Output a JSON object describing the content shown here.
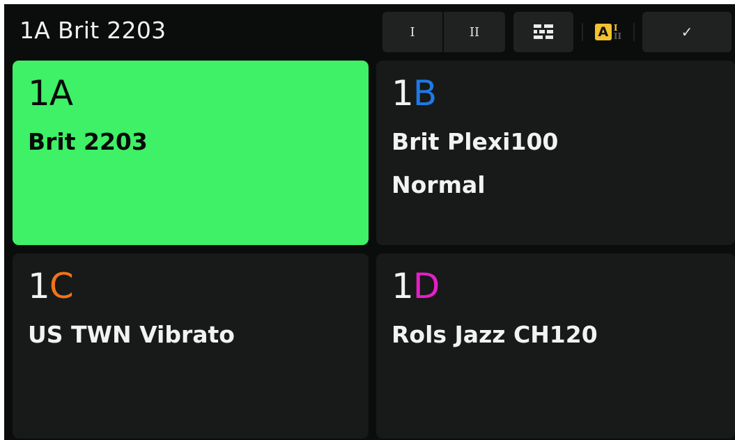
{
  "header": {
    "title": "1A Brit 2203",
    "buttons": {
      "seg_i": "I",
      "seg_ii": "II",
      "layout_icon": "grid-layout-icon",
      "ab_badge": "A",
      "ab_top": "I",
      "ab_bottom": "II",
      "check": "✓"
    }
  },
  "tiles": [
    {
      "bank": "1",
      "letter": "A",
      "letter_color": "#0a0a0a",
      "name_lines": [
        "Brit 2203"
      ],
      "active": true,
      "bg": "#3ef166"
    },
    {
      "bank": "1",
      "letter": "B",
      "letter_color": "#1f7ae6",
      "name_lines": [
        "Brit Plexi100",
        "Normal"
      ],
      "active": false
    },
    {
      "bank": "1",
      "letter": "C",
      "letter_color": "#f0741a",
      "name_lines": [
        "US TWN Vibrato"
      ],
      "active": false
    },
    {
      "bank": "1",
      "letter": "D",
      "letter_color": "#e61fc4",
      "name_lines": [
        "Rols Jazz CH120"
      ],
      "active": false
    }
  ],
  "colors": {
    "background": "#0b0d0c",
    "tile": "#171a18",
    "active_tile": "#3ef166",
    "badge": "#f2c12e"
  }
}
